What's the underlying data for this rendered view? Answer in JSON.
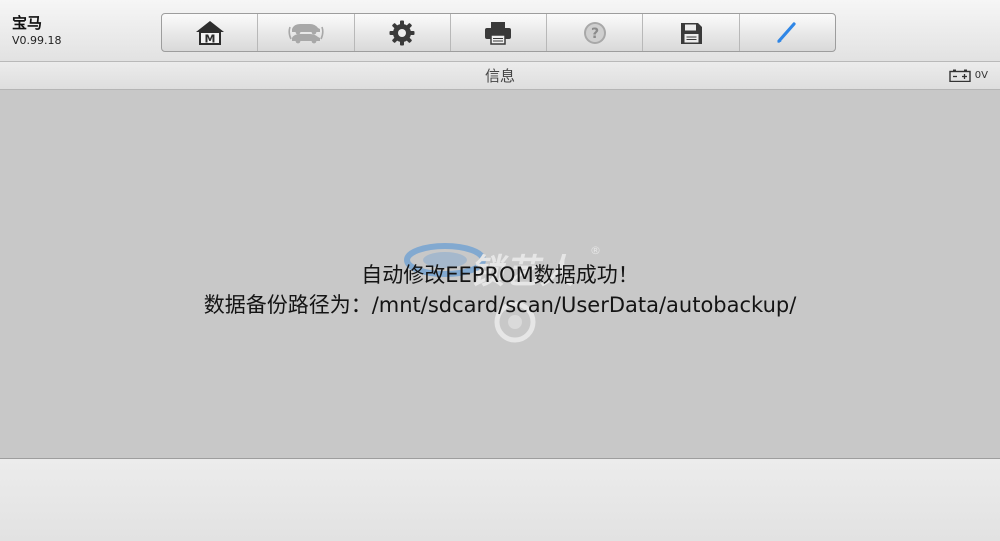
{
  "header": {
    "vehicle_name": "宝马",
    "version": "V0.99.18"
  },
  "toolbar": {
    "buttons": [
      {
        "icon": "home-icon",
        "enabled": true
      },
      {
        "icon": "vehicle-swap-icon",
        "enabled": false
      },
      {
        "icon": "gear-icon",
        "enabled": true
      },
      {
        "icon": "printer-icon",
        "enabled": true
      },
      {
        "icon": "help-icon",
        "enabled": false
      },
      {
        "icon": "save-icon",
        "enabled": true
      },
      {
        "icon": "pen-icon",
        "enabled": true
      }
    ]
  },
  "titlebar": {
    "title": "信息",
    "battery_voltage": "0V"
  },
  "content": {
    "message_line1": "自动修改EEPROM数据成功！",
    "message_line2": "数据备份路径为：/mnt/sdcard/scan/UserData/autobackup/"
  },
  "watermark": {
    "text": "锁艺人"
  },
  "colors": {
    "accent_blue": "#2f86e6",
    "content_bg": "#c8c8c8",
    "icon_dark": "#3a3a3a",
    "icon_disabled": "#a8a8a8"
  }
}
